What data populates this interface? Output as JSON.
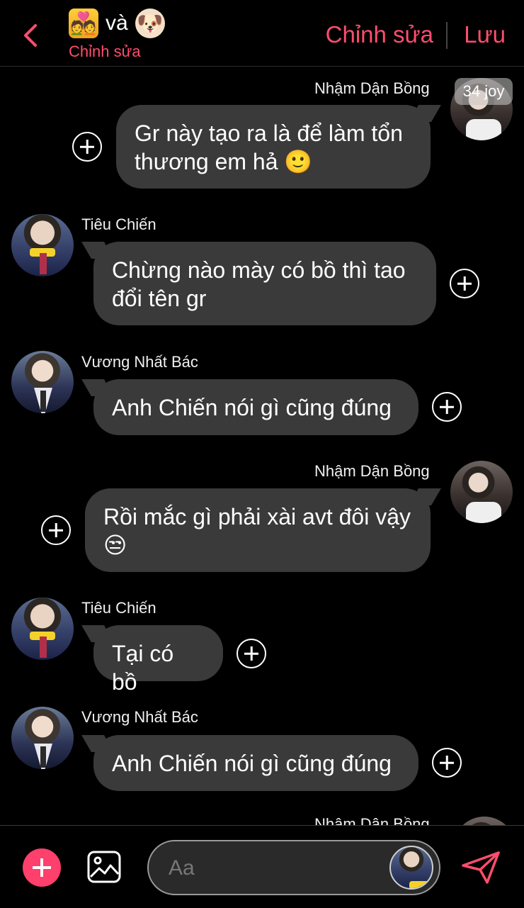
{
  "header": {
    "title_connector": "và",
    "subtitle": "Chỉnh sửa",
    "edit_label": "Chỉnh sửa",
    "save_label": "Lưu",
    "emoji_left": "💑",
    "emoji_right": "🐶"
  },
  "watermark": "34 joy",
  "messages": [
    {
      "sender": "Nhậm Dận Bồng",
      "text_lines": [
        "Gr này tạo ra là để làm tổn",
        "thương em hả 🙂"
      ],
      "side": "right"
    },
    {
      "sender": "Tiêu Chiến",
      "text_lines": [
        "Chừng nào mày có bồ thì tao",
        "đổi tên gr"
      ],
      "side": "left"
    },
    {
      "sender": "Vương Nhất Bác",
      "text_lines": [
        "Anh Chiến nói gì cũng đúng"
      ],
      "side": "left"
    },
    {
      "sender": "Nhậm Dận Bồng",
      "text_lines": [
        "Rồi mắc gì phải xài avt đôi vậy",
        "😒"
      ],
      "side": "right"
    },
    {
      "sender": "Tiêu Chiến",
      "text_lines": [
        "Tại có bồ"
      ],
      "side": "left"
    },
    {
      "sender": "Vương Nhất Bác",
      "text_lines": [
        "Anh Chiến nói gì cũng đúng"
      ],
      "side": "left"
    }
  ],
  "partial_sender": "Nhậm Dận Bồng",
  "composer": {
    "placeholder": "Aa"
  },
  "colors": {
    "accent": "#ff4d6d",
    "bubble": "#3a3a3a",
    "background": "#000000"
  },
  "icons": [
    "back-chevron-icon",
    "plus-icon",
    "gallery-icon",
    "send-icon",
    "add-reaction-icon"
  ]
}
